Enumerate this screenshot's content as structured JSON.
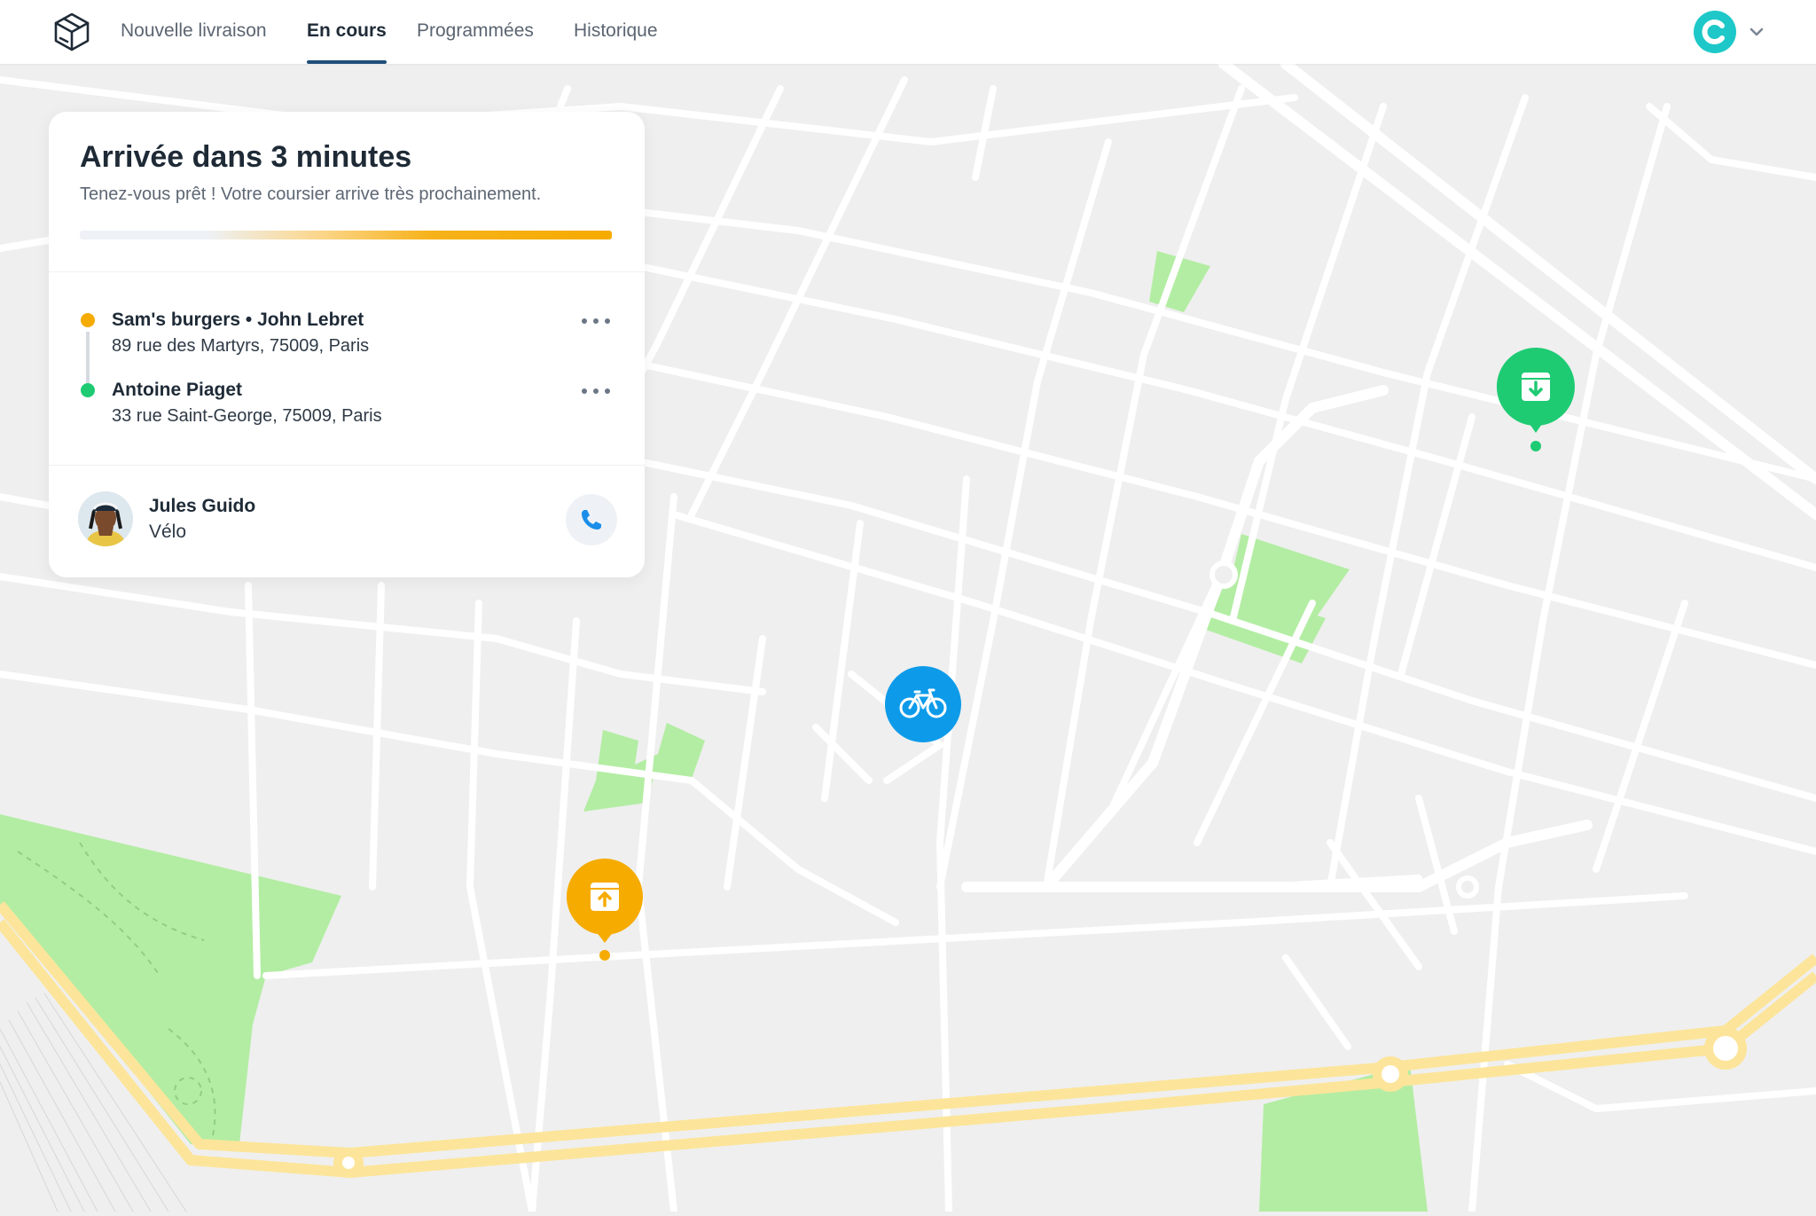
{
  "nav": {
    "logo_icon": "box-logo-icon",
    "tabs": [
      {
        "label": "Nouvelle livraison"
      },
      {
        "label": "En cours"
      },
      {
        "label": "Programmées"
      },
      {
        "label": "Historique"
      }
    ],
    "active_tab": "En cours",
    "account_icon": "c-brand-avatar",
    "account_color": "#1ec8c8"
  },
  "delivery": {
    "title": "Arrivée dans 3 minutes",
    "subtitle": "Tenez-vous prêt ! Votre coursier arrive très prochainement.",
    "progress": 0.76,
    "progress_color": "#f6ab00",
    "stops": [
      {
        "name": "Sam's burgers • John Lebret",
        "address": "89 rue des Martyrs, 75009, Paris",
        "color": "#f6ab00",
        "icon": "more-dots-icon"
      },
      {
        "name": "Antoine Piaget",
        "address": "33 rue Saint-George, 75009, Paris",
        "color": "#1ecb73",
        "icon": "more-dots-icon"
      }
    ]
  },
  "courier": {
    "name": "Jules Guido",
    "vehicle": "Vélo",
    "call_icon": "phone-icon",
    "call_color": "#1a8ee8"
  },
  "map": {
    "pickup_marker": {
      "icon": "pickup-box-icon",
      "color": "#f6ab00"
    },
    "dropoff_marker": {
      "icon": "dropoff-box-icon",
      "color": "#1ecb73"
    },
    "courier_marker": {
      "icon": "bicycle-icon",
      "color": "#0d9be9"
    },
    "park_color": "#b3eda3",
    "rail_color": "#fce59a"
  }
}
